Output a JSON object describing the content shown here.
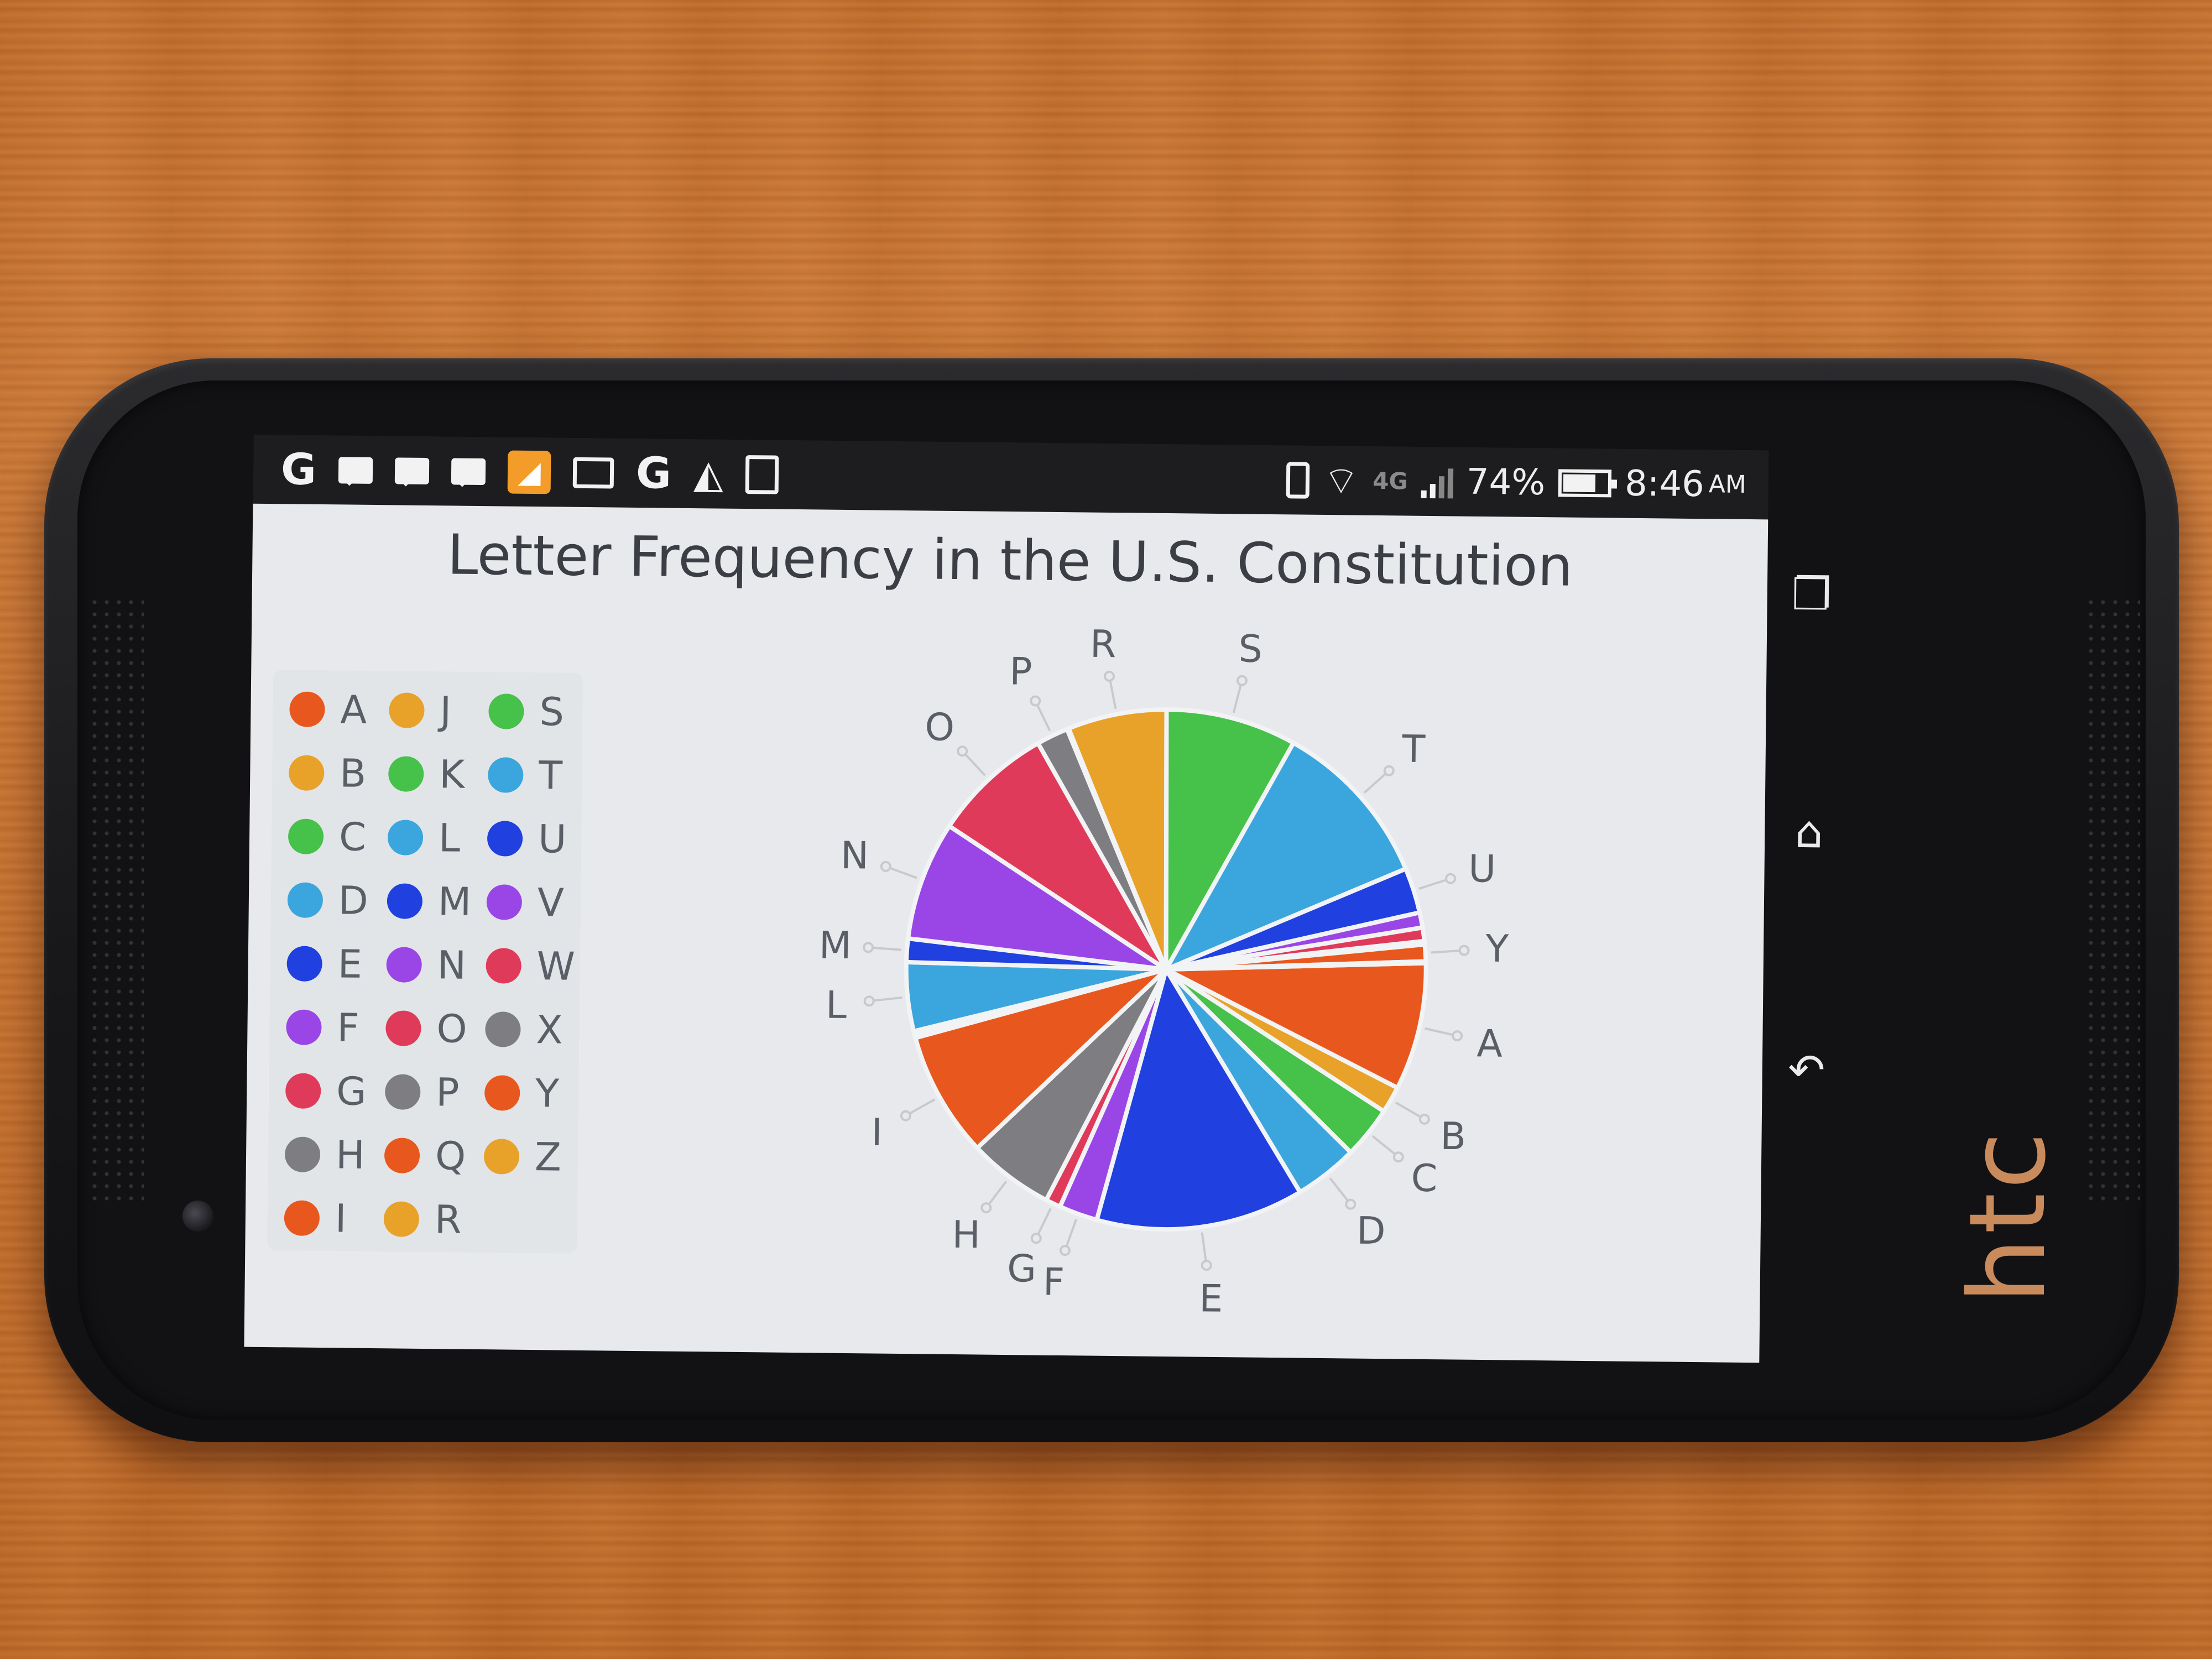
{
  "status_bar": {
    "icons_left": [
      "google-icon",
      "chat-icon",
      "chat-icon",
      "chat-icon",
      "rss-icon",
      "mail-icon",
      "google-icon",
      "shoe-icon",
      "clipboard-icon"
    ],
    "battery_percent": "74%",
    "time": "8:46",
    "ampm": "AM",
    "network": "4G"
  },
  "device": {
    "brand": "htc"
  },
  "nav_icons": [
    "recent-apps-icon",
    "home-icon",
    "back-icon"
  ],
  "chart_data": {
    "type": "pie",
    "title": "Letter Frequency in the U.S. Constitution",
    "legend_position": "left",
    "categories": [
      "A",
      "B",
      "C",
      "D",
      "E",
      "F",
      "G",
      "H",
      "I",
      "J",
      "K",
      "L",
      "M",
      "N",
      "O",
      "P",
      "Q",
      "R",
      "S",
      "T",
      "U",
      "V",
      "W",
      "X",
      "Y",
      "Z"
    ],
    "values": [
      7.6,
      1.6,
      3.1,
      3.8,
      12.4,
      2.3,
      0.9,
      5.1,
      7.5,
      0.2,
      0.2,
      4.1,
      1.4,
      7.1,
      7.2,
      1.9,
      0.1,
      5.9,
      7.8,
      10.1,
      2.7,
      0.9,
      0.8,
      0.2,
      1.0,
      0.1
    ],
    "colors": {
      "A": "#e8581e",
      "B": "#e8a22a",
      "C": "#46c14a",
      "D": "#3aa6dd",
      "E": "#2040e0",
      "F": "#9a46e6",
      "G": "#e03a5a",
      "H": "#7e7e82",
      "I": "#e8581e",
      "J": "#e8a22a",
      "K": "#46c14a",
      "L": "#3aa6dd",
      "M": "#2040e0",
      "N": "#9a46e6",
      "O": "#e03a5a",
      "P": "#7e7e82",
      "Q": "#e8581e",
      "R": "#e8a22a",
      "S": "#46c14a",
      "T": "#3aa6dd",
      "U": "#2040e0",
      "V": "#9a46e6",
      "W": "#e03a5a",
      "X": "#7e7e82",
      "Y": "#e8581e",
      "Z": "#e8a22a"
    },
    "pie_labels_shown": [
      "R",
      "S",
      "T",
      "U",
      "Y",
      "A",
      "B",
      "C",
      "D",
      "E",
      "F",
      "G",
      "H",
      "I",
      "L",
      "M",
      "N",
      "O",
      "P"
    ]
  }
}
